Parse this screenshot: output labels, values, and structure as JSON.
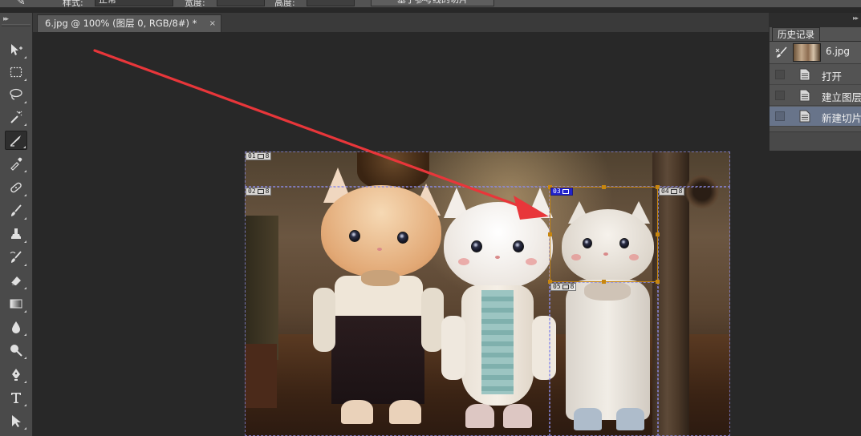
{
  "options_bar": {
    "style_label": "样式:",
    "style_value": "正常",
    "width_label": "宽度:",
    "height_label": "高度:",
    "guides_button": "基于参考线的切片"
  },
  "document_tab": {
    "title": "6.jpg @ 100% (图层 0, RGB/8#) *",
    "close": "×"
  },
  "toolbox": {
    "collapse": "▸▸",
    "tools": [
      {
        "name": "move-tool-icon"
      },
      {
        "name": "marquee-tool-icon"
      },
      {
        "name": "lasso-tool-icon"
      },
      {
        "name": "magic-wand-tool-icon"
      },
      {
        "name": "slice-tool-icon",
        "active": true
      },
      {
        "name": "eyedropper-tool-icon"
      },
      {
        "name": "healing-brush-tool-icon"
      },
      {
        "name": "brush-tool-icon"
      },
      {
        "name": "clone-stamp-tool-icon"
      },
      {
        "name": "history-brush-tool-icon"
      },
      {
        "name": "eraser-tool-icon"
      },
      {
        "name": "gradient-tool-icon"
      },
      {
        "name": "blur-tool-icon"
      },
      {
        "name": "dodge-tool-icon"
      },
      {
        "name": "pen-tool-icon"
      },
      {
        "name": "type-tool-icon"
      },
      {
        "name": "path-selection-tool-icon"
      }
    ]
  },
  "slices": [
    {
      "id": "01",
      "count": "8",
      "selected": false
    },
    {
      "id": "02",
      "count": "8",
      "selected": false
    },
    {
      "id": "03",
      "count": "",
      "selected": true
    },
    {
      "id": "04",
      "count": "8",
      "selected": false
    },
    {
      "id": "05",
      "count": "8",
      "selected": false
    }
  ],
  "history_panel": {
    "tab_label": "历史记录",
    "snapshot_name": "6.jpg",
    "steps": [
      {
        "label": "打开",
        "current": false
      },
      {
        "label": "建立图层",
        "current": false
      },
      {
        "label": "新建切片",
        "current": true
      }
    ],
    "menu_dots": "▸▸"
  },
  "colors": {
    "annotation_arrow": "#e8363a",
    "selected_slice": "#c8860e",
    "slice_line": "#8c8ce6",
    "history_highlight": "#68748a"
  }
}
